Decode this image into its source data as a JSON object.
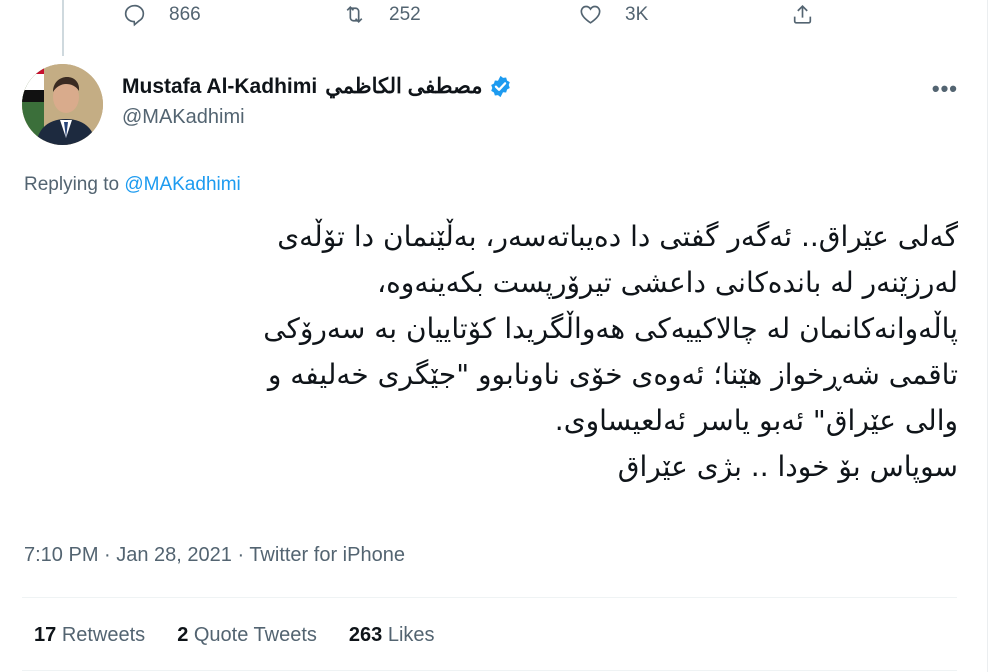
{
  "actions": {
    "reply_count": "866",
    "retweet_count": "252",
    "like_count": "3K"
  },
  "author": {
    "name": "Mustafa Al-Kadhimi",
    "name_arabic": "مصطفى الكاظمي",
    "handle": "@MAKadhimi",
    "more": "•••"
  },
  "replying": {
    "prefix": "Replying to",
    "mention": "@MAKadhimi"
  },
  "tweet": {
    "lines": [
      "گەلی عێراق.. ئەگەر گفتی دا دەیباتەسەر، بەڵێنمان دا تۆڵەی",
      "لەرزێنەر لە باندەکانی داعشی تیرۆرپست بکەینەوە،",
      "پاڵەوانەکانمان لە چالاکییەکی هەواڵگریدا کۆتاییان بە سەرۆکی",
      "تاقمی شەڕخواز هێنا؛ ئەوەی خۆی ناونابوو \"جێگری خەلیفە و",
      "والی عێراق\" ئەبو یاسر ئەلعیساوی.",
      "سوپاس بۆ خودا .. بژی عێراق"
    ]
  },
  "meta": {
    "time": "7:10 PM · Jan 28, 2021 · Twitter for iPhone"
  },
  "stats": {
    "retweets_count": "17",
    "retweets_label": "Retweets",
    "quotes_count": "2",
    "quotes_label": "Quote Tweets",
    "likes_count": "263",
    "likes_label": "Likes"
  },
  "colors": {
    "accent": "#1d9bf0",
    "muted": "#536471",
    "text": "#0f1419"
  }
}
